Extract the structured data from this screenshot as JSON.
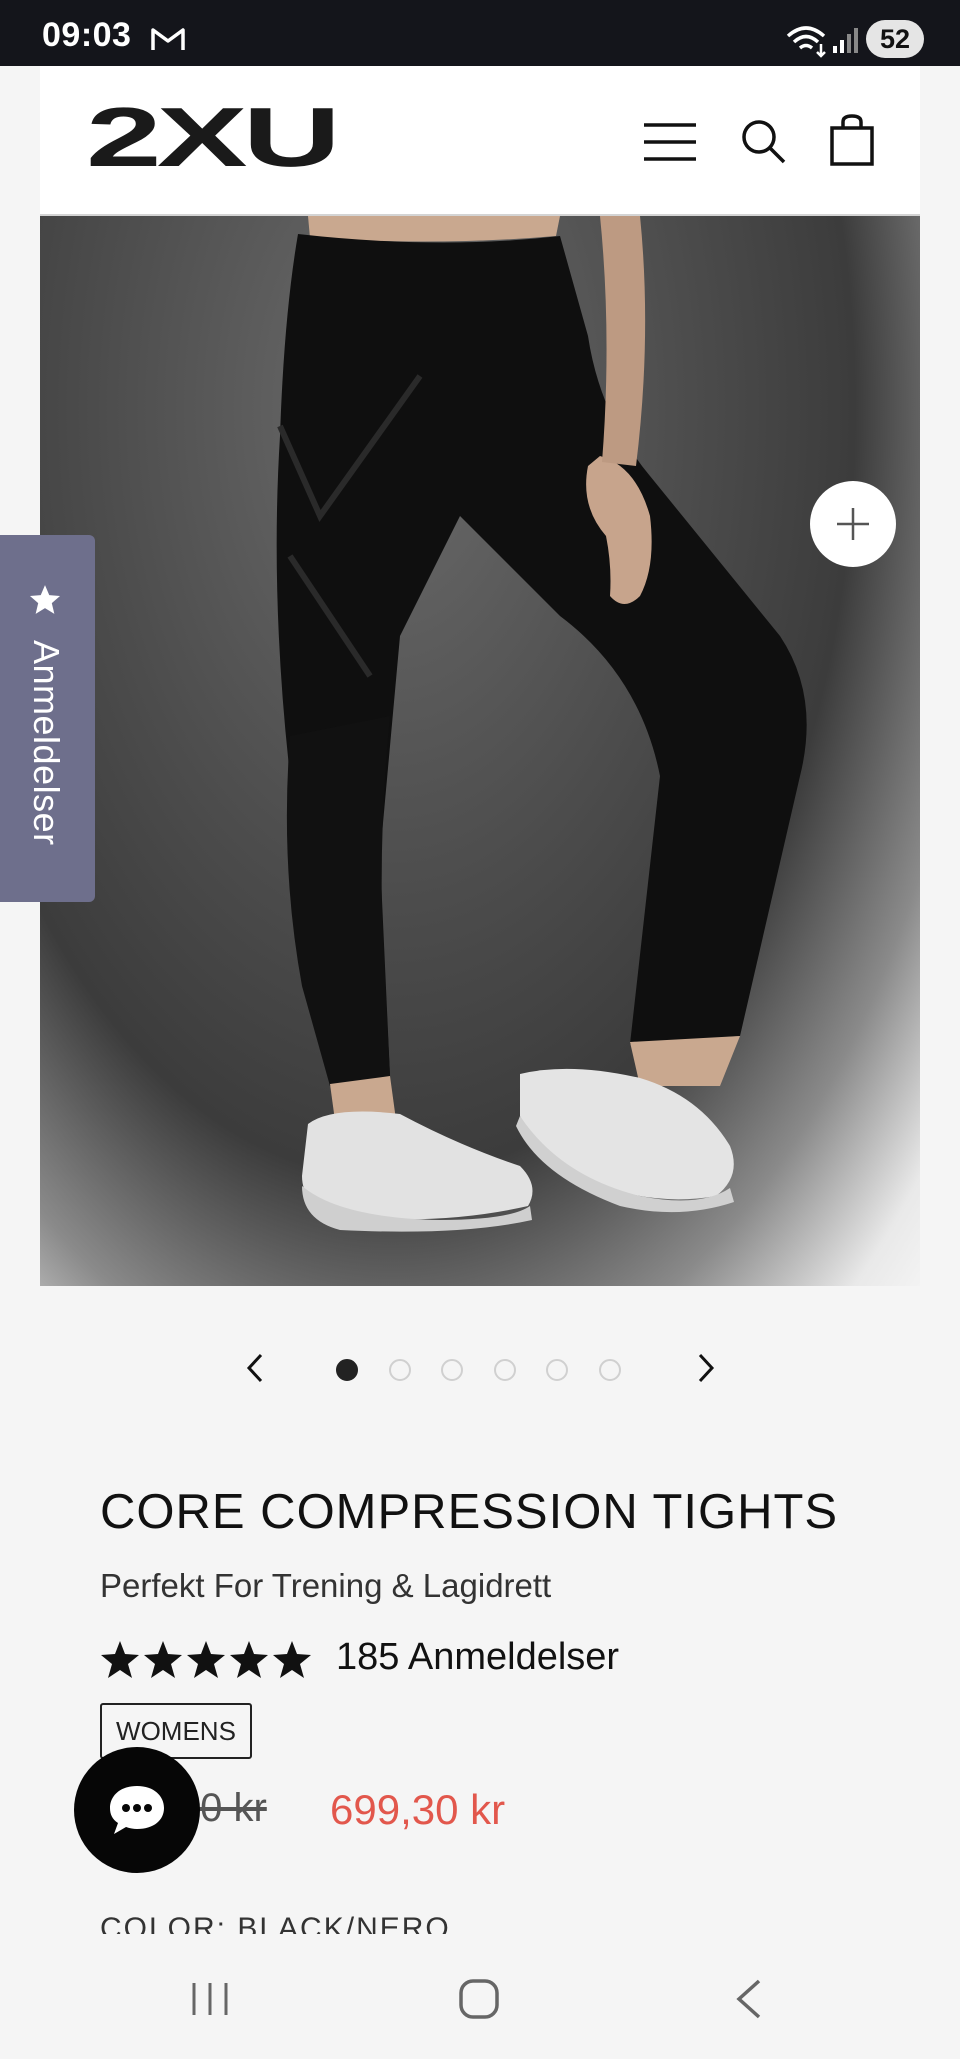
{
  "status_bar": {
    "time": "09:03",
    "battery": "52",
    "icons": [
      "gmail-icon",
      "wifi-icon",
      "signal-icon"
    ]
  },
  "header": {
    "logo_text": "2XU",
    "icons": [
      "menu-icon",
      "search-icon",
      "cart-icon"
    ]
  },
  "gallery": {
    "image_alt": "Core Compression Tights",
    "zoom_icon": "plus-icon",
    "slide_count": 6,
    "active_slide": 1
  },
  "reviews_tab": {
    "label": "Anmeldelser",
    "icon": "star-icon"
  },
  "product": {
    "title": "CORE COMPRESSION TIGHTS",
    "subtitle": "Perfekt For Trening & Lagidrett",
    "rating": 4.9,
    "review_count": "185 Anmeldelser",
    "badge": "WOMENS",
    "old_price": "999,00 kr",
    "sale_price": "699,30 kr",
    "color_label": "COLOR: BLACK/NERO"
  },
  "chat": {
    "icon": "chat-bubble-icon"
  },
  "colors": {
    "sale": "#e2574c",
    "reviews_tab": "#6e6f8c",
    "status_bar": "#14151b"
  },
  "nav_bar": {
    "icons": [
      "recents-icon",
      "home-icon",
      "back-icon"
    ]
  }
}
